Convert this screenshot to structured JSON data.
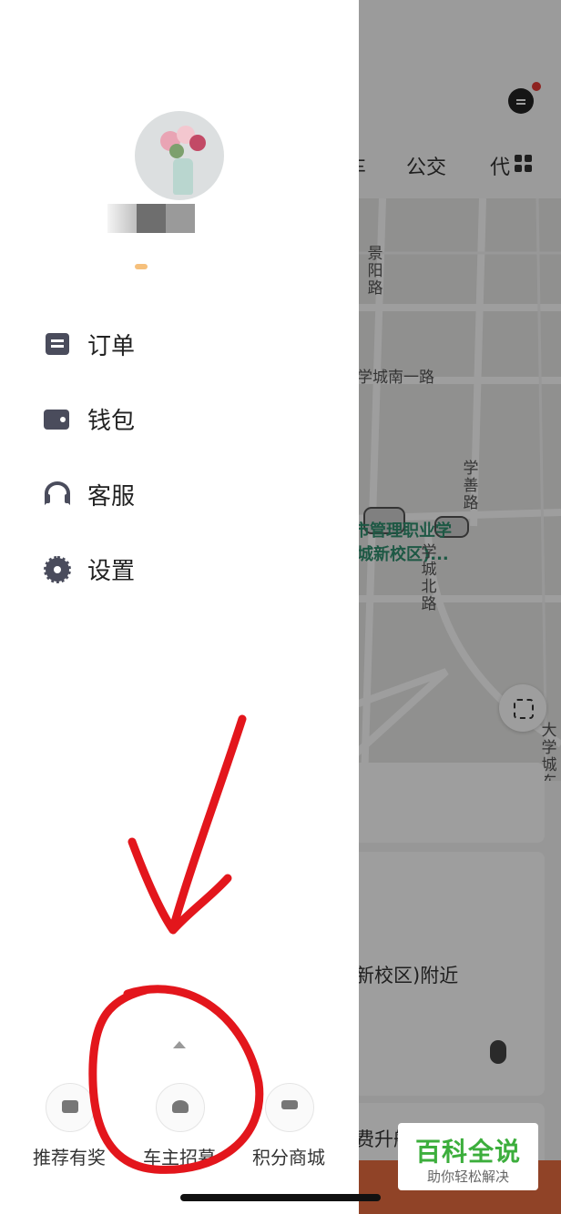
{
  "map_app": {
    "top_tabs": [
      "车",
      "公交",
      "代"
    ],
    "map_labels": {
      "road_jingyang": "景阳路",
      "road_xuecheng_south1": "学城南一路",
      "road_xueshan": "学善路",
      "school_line1": "市管理职业学",
      "school_line2": "城新校区)...",
      "road_xuecheng_north": "学城北路",
      "road_daxuecheng_east": "大学城东路"
    },
    "location_text": "新校区)附近",
    "promo_text": "费升舱"
  },
  "drawer": {
    "menu": [
      {
        "label": "订单",
        "icon": "order-icon"
      },
      {
        "label": "钱包",
        "icon": "wallet-icon"
      },
      {
        "label": "客服",
        "icon": "headset-icon"
      },
      {
        "label": "设置",
        "icon": "gear-icon"
      }
    ],
    "bottom_actions": [
      {
        "label": "推荐有奖",
        "icon": "gift-icon"
      },
      {
        "label": "车主招募",
        "icon": "driver-icon"
      },
      {
        "label": "积分商城",
        "icon": "cart-icon"
      }
    ]
  },
  "watermark": {
    "title": "百科全说",
    "subtitle": "助你轻松解决"
  },
  "colors": {
    "annotation_red": "#e3161c",
    "watermark_green": "#3cae3c",
    "icon_gray": "#4a4c5c"
  }
}
